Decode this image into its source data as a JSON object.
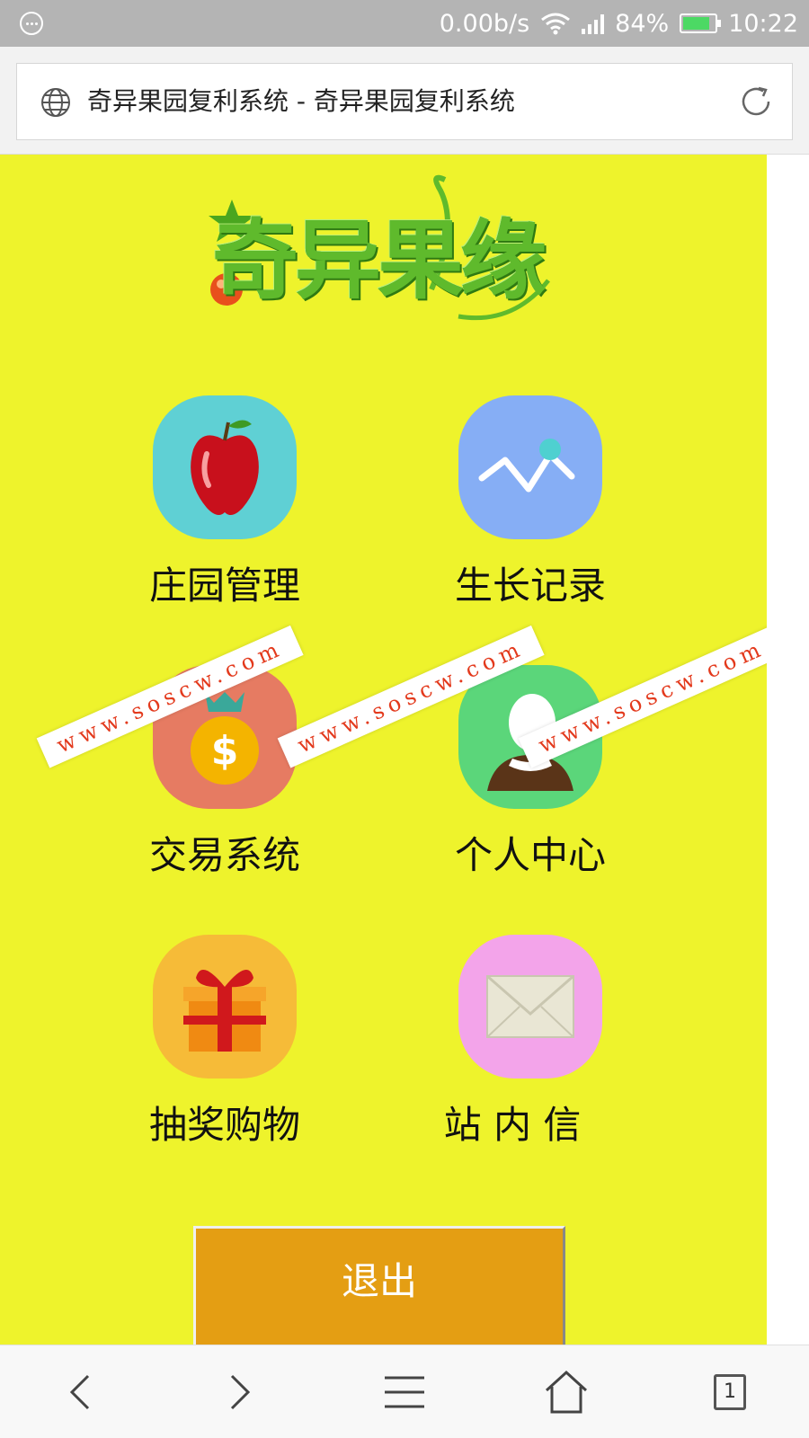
{
  "status_bar": {
    "network_speed": "0.00b/s",
    "battery_percent": "84%",
    "battery_level": 0.84,
    "time": "10:22",
    "icons": [
      "menu-icon",
      "wifi-icon",
      "signal-icon",
      "battery-icon"
    ]
  },
  "browser": {
    "page_title": "奇异果园复利系统 - 奇异果园复利系统",
    "icons": [
      "globe-icon",
      "reload-icon"
    ]
  },
  "logo": {
    "text": "奇异果缘"
  },
  "menu": {
    "items": [
      {
        "id": "estate",
        "label": "庄园管理",
        "icon": "apple-icon",
        "bg": "#5fd0d4"
      },
      {
        "id": "growth",
        "label": "生长记录",
        "icon": "trend-line-icon",
        "bg": "#86aef5"
      },
      {
        "id": "trade",
        "label": "交易系统",
        "icon": "money-bag-icon",
        "bg": "#e67b62"
      },
      {
        "id": "personal",
        "label": "个人中心",
        "icon": "person-icon",
        "bg": "#5bd67a"
      },
      {
        "id": "lottery",
        "label": "抽奖购物",
        "icon": "gift-icon",
        "bg": "#f6bb38"
      },
      {
        "id": "mail",
        "label": "站 内 信",
        "icon": "envelope-icon",
        "bg": "#f3a4ea"
      }
    ]
  },
  "logout": {
    "label": "退出"
  },
  "watermark": {
    "text": "WWW.SOSCW.COM",
    "text_lower": "www.soscw.com"
  },
  "bottom_nav": {
    "tab_count": "1",
    "icons": [
      "back-icon",
      "forward-icon",
      "menu-lines-icon",
      "home-icon",
      "tabs-icon"
    ]
  },
  "colors": {
    "page_bg": "#eef32c",
    "logout_bg": "#e49e13",
    "watermark_text": "#e33a1d"
  }
}
